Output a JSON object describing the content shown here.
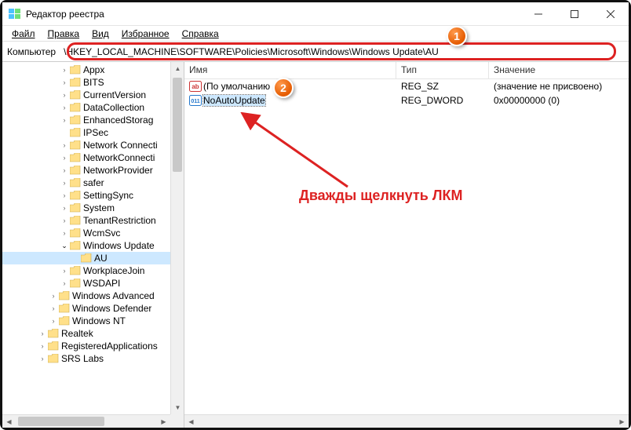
{
  "window": {
    "title": "Редактор реестра"
  },
  "menu": {
    "file": "Файл",
    "edit": "Правка",
    "view": "Вид",
    "favorites": "Избранное",
    "help": "Справка"
  },
  "address": {
    "label": "Компьютер",
    "path": "\\HKEY_LOCAL_MACHINE\\SOFTWARE\\Policies\\Microsoft\\Windows\\Windows Update\\AU"
  },
  "tree": {
    "items": [
      {
        "indent": 5,
        "chev": "right",
        "label": "Appx"
      },
      {
        "indent": 5,
        "chev": "right",
        "label": "BITS"
      },
      {
        "indent": 5,
        "chev": "right",
        "label": "CurrentVersion"
      },
      {
        "indent": 5,
        "chev": "right",
        "label": "DataCollection"
      },
      {
        "indent": 5,
        "chev": "right",
        "label": "EnhancedStorag"
      },
      {
        "indent": 5,
        "chev": "",
        "label": "IPSec"
      },
      {
        "indent": 5,
        "chev": "right",
        "label": "Network Connecti"
      },
      {
        "indent": 5,
        "chev": "right",
        "label": "NetworkConnecti"
      },
      {
        "indent": 5,
        "chev": "right",
        "label": "NetworkProvider"
      },
      {
        "indent": 5,
        "chev": "right",
        "label": "safer"
      },
      {
        "indent": 5,
        "chev": "right",
        "label": "SettingSync"
      },
      {
        "indent": 5,
        "chev": "right",
        "label": "System"
      },
      {
        "indent": 5,
        "chev": "right",
        "label": "TenantRestriction"
      },
      {
        "indent": 5,
        "chev": "right",
        "label": "WcmSvc"
      },
      {
        "indent": 5,
        "chev": "open",
        "label": "Windows Update"
      },
      {
        "indent": 6,
        "chev": "",
        "label": "AU",
        "selected": true
      },
      {
        "indent": 5,
        "chev": "right",
        "label": "WorkplaceJoin"
      },
      {
        "indent": 5,
        "chev": "right",
        "label": "WSDAPI"
      },
      {
        "indent": 4,
        "chev": "right",
        "label": "Windows Advanced"
      },
      {
        "indent": 4,
        "chev": "right",
        "label": "Windows Defender"
      },
      {
        "indent": 4,
        "chev": "right",
        "label": "Windows NT"
      },
      {
        "indent": 3,
        "chev": "right",
        "label": "Realtek"
      },
      {
        "indent": 3,
        "chev": "right",
        "label": "RegisteredApplications"
      },
      {
        "indent": 3,
        "chev": "right",
        "label": "SRS Labs"
      }
    ]
  },
  "list": {
    "headers": {
      "name": "Имя",
      "type": "Тип",
      "value": "Значение"
    },
    "rows": [
      {
        "icon": "string",
        "name": "(По умолчанию",
        "type": "REG_SZ",
        "value": "(значение не присвоено)"
      },
      {
        "icon": "dword",
        "name": "NoAutoUpdate",
        "type": "REG_DWORD",
        "value": "0x00000000 (0)",
        "selected": true
      }
    ]
  },
  "annotations": {
    "callout1": "1",
    "callout2": "2",
    "hint": "Дважды щелкнуть ЛКМ"
  }
}
